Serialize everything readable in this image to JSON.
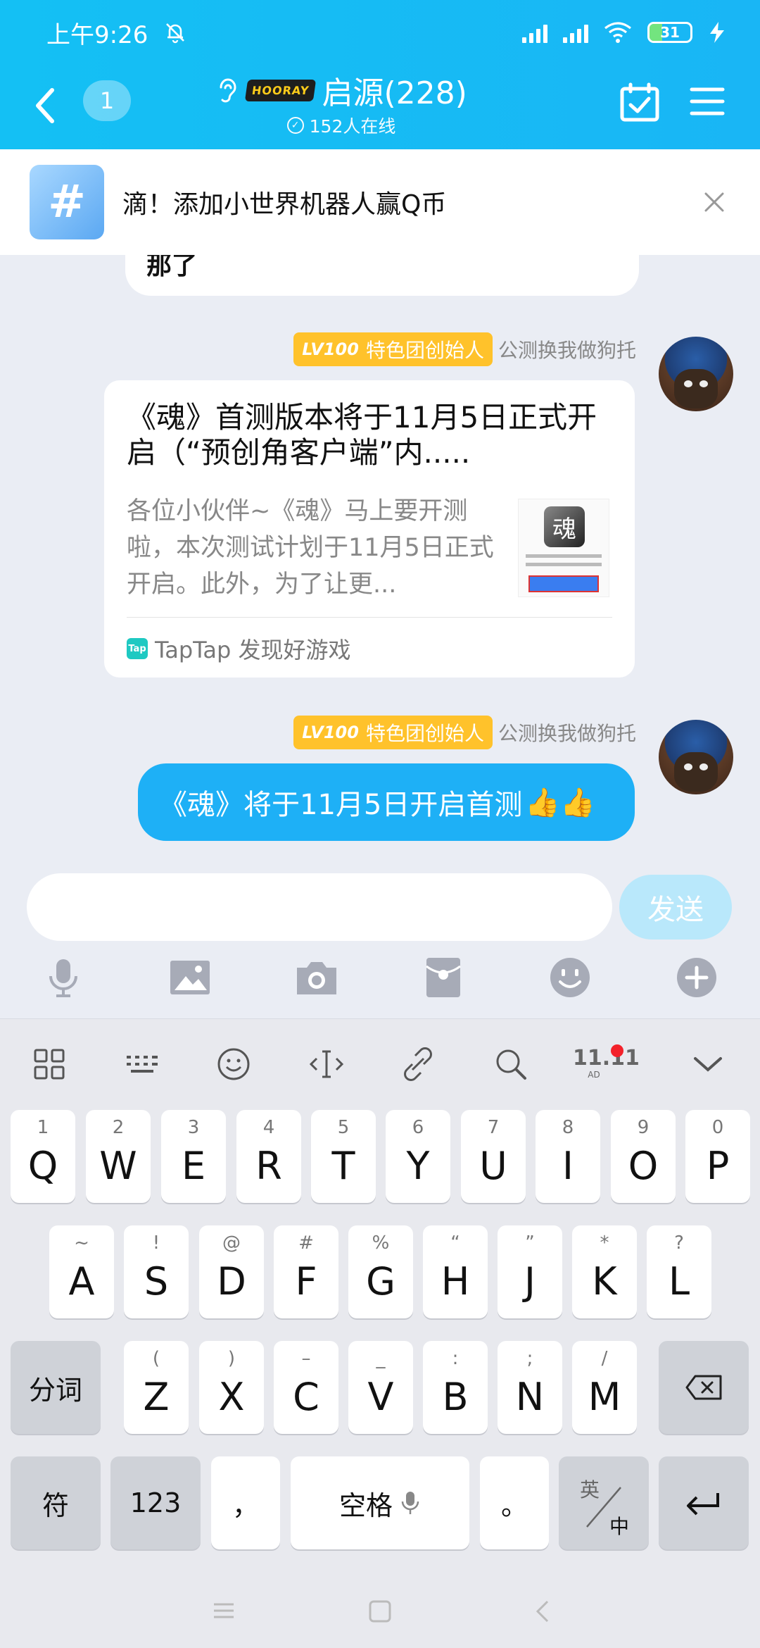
{
  "status_bar": {
    "time": "上午9:26",
    "battery": "31",
    "battery_level": 0.31
  },
  "header": {
    "unread_count": "1",
    "badge_text": "HOORAY",
    "group_name": "启源(228)",
    "online_text": "152人在线"
  },
  "banner": {
    "text": "滴！添加小世界机器人赢Q币"
  },
  "chat": {
    "previous_message": "那了",
    "messages": [
      {
        "level": "LV100",
        "title_badge": "特色团创始人",
        "sender": "公测换我做狗托",
        "card": {
          "title": "《魂》首测版本将于11月5日正式开启（“预创角客户端”内.....",
          "description": "各位小伙伴~《魂》马上要开测啦，本次测试计划于11月5日正式开启。此外，为了让更...",
          "source": "TapTap 发现好游戏",
          "source_icon": "Tap",
          "thumb_char": "魂"
        }
      },
      {
        "level": "LV100",
        "title_badge": "特色团创始人",
        "sender": "公测换我做狗托",
        "text": "《魂》将于11月5日开启首测",
        "emoji": "👍👍"
      }
    ]
  },
  "composer": {
    "value": "",
    "send_label": "发送"
  },
  "keyboard": {
    "row1": [
      {
        "sup": "1",
        "label": "Q"
      },
      {
        "sup": "2",
        "label": "W"
      },
      {
        "sup": "3",
        "label": "E"
      },
      {
        "sup": "4",
        "label": "R"
      },
      {
        "sup": "5",
        "label": "T"
      },
      {
        "sup": "6",
        "label": "Y"
      },
      {
        "sup": "7",
        "label": "U"
      },
      {
        "sup": "8",
        "label": "I"
      },
      {
        "sup": "9",
        "label": "O"
      },
      {
        "sup": "0",
        "label": "P"
      }
    ],
    "row2": [
      {
        "sup": "~",
        "label": "A"
      },
      {
        "sup": "!",
        "label": "S"
      },
      {
        "sup": "@",
        "label": "D"
      },
      {
        "sup": "#",
        "label": "F"
      },
      {
        "sup": "%",
        "label": "G"
      },
      {
        "sup": "“",
        "label": "H"
      },
      {
        "sup": "”",
        "label": "J"
      },
      {
        "sup": "*",
        "label": "K"
      },
      {
        "sup": "?",
        "label": "L"
      }
    ],
    "row3": [
      {
        "sup": "(",
        "label": "Z"
      },
      {
        "sup": ")",
        "label": "X"
      },
      {
        "sup": "–",
        "label": "C"
      },
      {
        "sup": "_",
        "label": "V"
      },
      {
        "sup": ":",
        "label": "B"
      },
      {
        "sup": ";",
        "label": "N"
      },
      {
        "sup": "/",
        "label": "M"
      }
    ],
    "segment_label": "分词",
    "symbol_label": "符",
    "num_label": "123",
    "comma_label": "，",
    "space_label": "空格",
    "period_label": "。",
    "lang_top": "英",
    "lang_bottom": "中",
    "toolbar_badge": "11.11",
    "toolbar_badge_sub": "AD"
  }
}
